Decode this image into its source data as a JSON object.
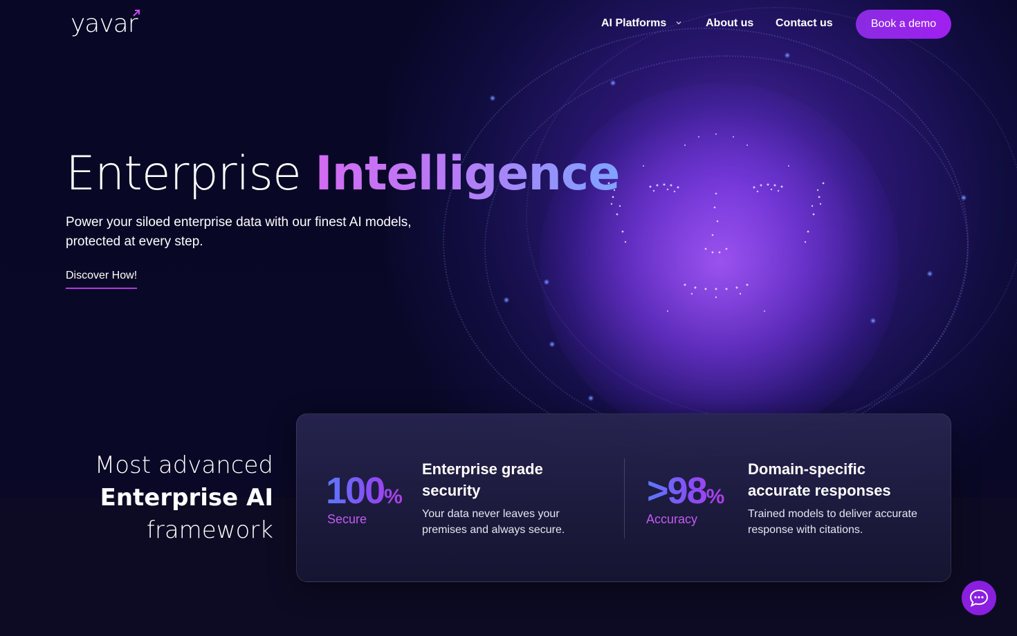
{
  "brand": {
    "name": "yavar",
    "accent_color": "#c94bf0"
  },
  "nav": {
    "items": [
      {
        "label": "AI Platforms",
        "has_dropdown": true
      },
      {
        "label": "About us"
      },
      {
        "label": "Contact us"
      }
    ],
    "cta_label": "Book a demo",
    "cta_color": "#9a24ea"
  },
  "hero": {
    "title_light": "Enterprise",
    "title_accent": "Intelligence",
    "subtitle": "Power your siloed enterprise data with our finest AI models, protected at every step.",
    "link_label": "Discover How!"
  },
  "framework": {
    "line1": "Most advanced",
    "line2": "Enterprise AI",
    "line3": "framework"
  },
  "stats": [
    {
      "value": "100",
      "unit": "%",
      "label": "Secure",
      "title": "Enterprise grade security",
      "description": "Your data never leaves your premises and always secure."
    },
    {
      "value": ">98",
      "unit": "%",
      "label": "Accuracy",
      "title": "Domain-specific accurate responses",
      "description": "Trained models to deliver accurate response with citations."
    }
  ],
  "chat": {
    "icon": "chat-bubble-icon",
    "color": "#8a1fe0"
  }
}
